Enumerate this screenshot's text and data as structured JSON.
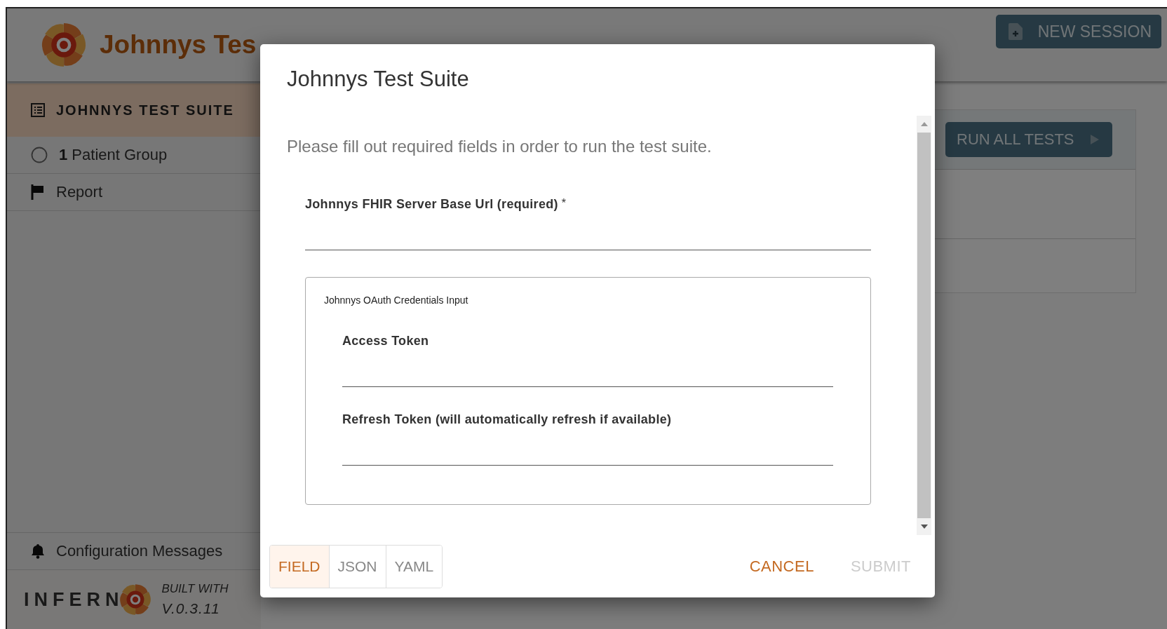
{
  "header": {
    "title": "Johnnys Tes",
    "new_session_button": "NEW SESSION"
  },
  "sidebar": {
    "heading": "JOHNNYS TEST SUITE",
    "items": [
      {
        "kind": "group",
        "number": "1",
        "label": "Patient Group"
      },
      {
        "kind": "report",
        "label": "Report"
      }
    ],
    "configuration_messages": "Configuration Messages",
    "footer": {
      "brand": "INFERN",
      "built_with": "BUILT WITH",
      "version": "V.0.3.11"
    }
  },
  "main": {
    "run_all_button": "RUN ALL TESTS"
  },
  "dialog": {
    "title": "Johnnys Test Suite",
    "description": "Please fill out required fields in order to run the test suite.",
    "fields": [
      {
        "label": "Johnnys FHIR Server Base Url (required)",
        "required_mark": "*"
      }
    ],
    "group": {
      "legend": "Johnnys OAuth Credentials Input",
      "fields": [
        {
          "label": "Access Token"
        },
        {
          "label": "Refresh Token (will automatically refresh if available)"
        }
      ]
    },
    "modes": [
      {
        "label": "FIELD",
        "selected": true
      },
      {
        "label": "JSON",
        "selected": false
      },
      {
        "label": "YAML",
        "selected": false
      }
    ],
    "actions": [
      {
        "label": "CANCEL",
        "disabled": false
      },
      {
        "label": "SUBMIT",
        "disabled": true
      }
    ]
  }
}
